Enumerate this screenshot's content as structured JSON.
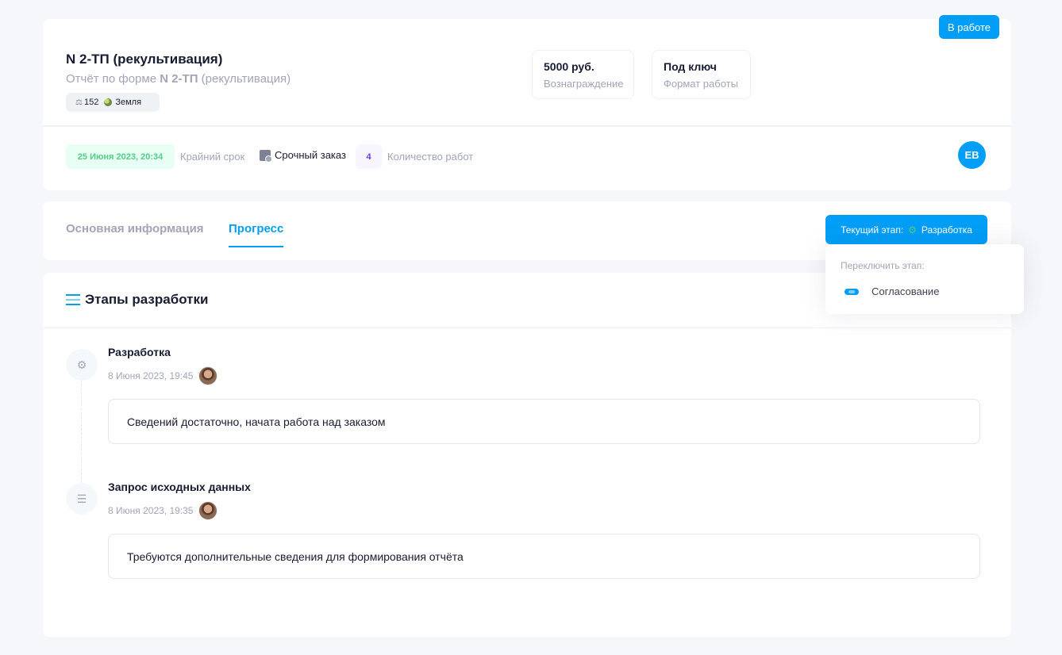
{
  "order": {
    "status": "В работе",
    "title": "N 2-ТП (рекультивация)",
    "subtitle_prefix": "Отчёт по форме ",
    "subtitle_form": "N 2-ТП",
    "subtitle_suffix": " (рекультивация)",
    "tag_icon": "scale-icon",
    "tag_count": "152",
    "tag_category": "Земля",
    "reward_value": "5000 руб.",
    "reward_label": "Вознаграждение",
    "format_value": "Под ключ",
    "format_label": "Формат работы",
    "deadline_date": "25 Июня 2023, 20:34",
    "deadline_label": "Крайний срок",
    "urgent_label": "Срочный заказ",
    "works_count": "4",
    "works_label": "Количество работ",
    "assignee_initials": "EB"
  },
  "tabs": [
    {
      "label": "Основная информация",
      "active": false
    },
    {
      "label": "Прогресс",
      "active": true
    }
  ],
  "stage_button": {
    "prefix": "Текущий этап:",
    "stage": "Разработка"
  },
  "dropdown": {
    "title": "Переключить этап:",
    "items": [
      {
        "label": "Согласование",
        "icon": "handshake-icon"
      }
    ]
  },
  "stages": {
    "title": "Этапы разработки",
    "items": [
      {
        "title": "Разработка",
        "date": "8 Июня 2023, 19:45",
        "comment": "Сведений достаточно, начата работа над заказом",
        "icon": "gears-icon"
      },
      {
        "title": "Запрос исходных данных",
        "date": "8 Июня 2023, 19:35",
        "comment": "Требуются дополнительные сведения для формирования отчёта",
        "icon": "list-icon"
      }
    ]
  },
  "colors": {
    "primary": "#009ef7",
    "success": "#50cd89",
    "info": "#7239ea",
    "muted": "#a1a5b7"
  }
}
